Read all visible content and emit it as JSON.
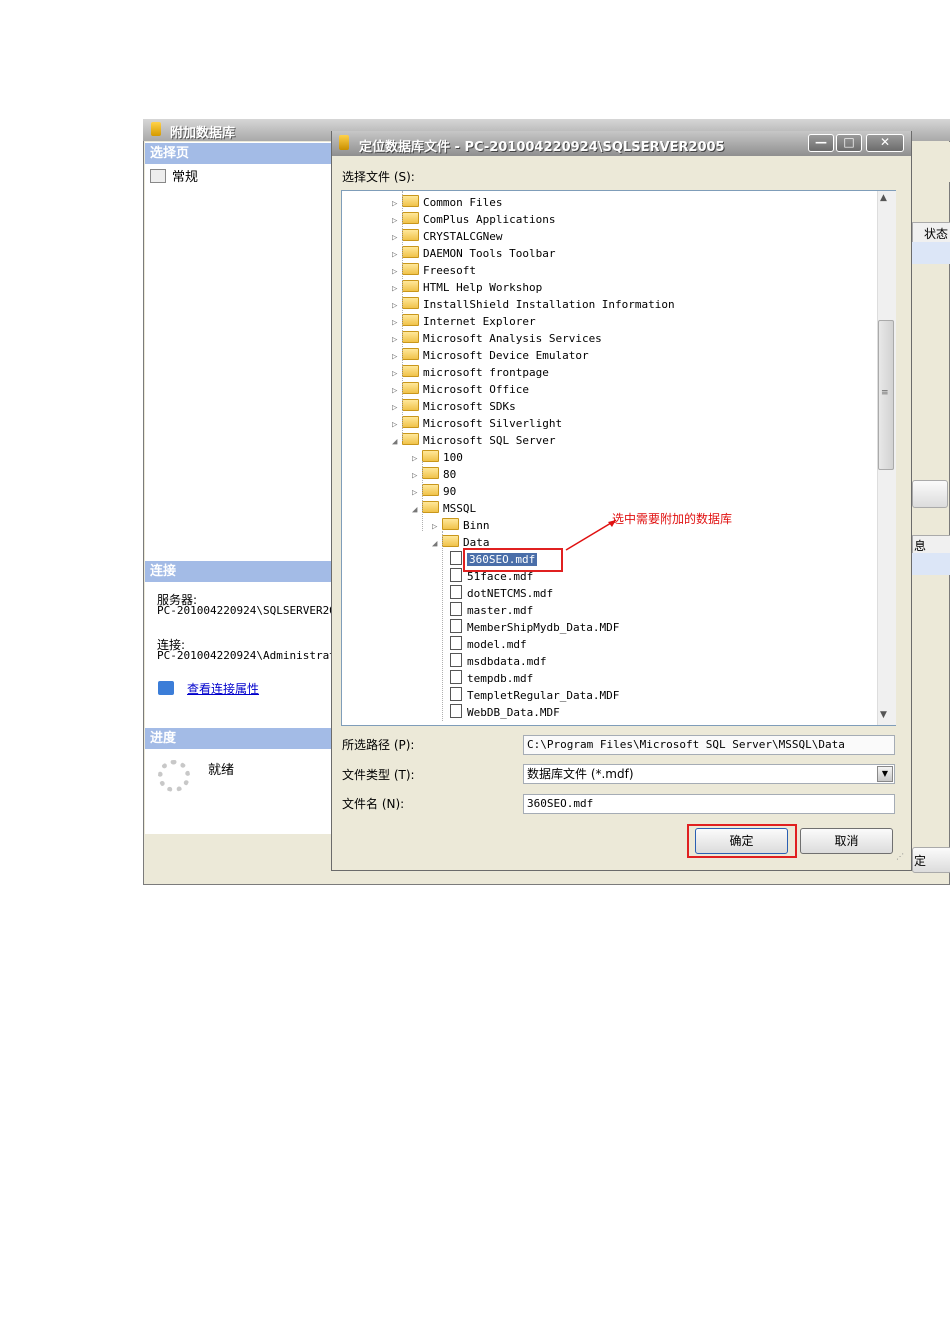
{
  "background_window": {
    "title": "附加数据库",
    "select_page_header": "选择页",
    "nav_general": "常规",
    "connection_header": "连接",
    "server_label": "服务器:",
    "server_value": "PC-201004220924\\SQLSERVER20",
    "connection_label": "连接:",
    "connection_value": "PC-201004220924\\Administrat",
    "view_props_link": "查看连接属性",
    "progress_header": "进度",
    "progress_status": "就绪",
    "right_col_header": "状态",
    "right_fragment_1": "息",
    "right_fragment_2": "定"
  },
  "dialog": {
    "title": "定位数据库文件 - PC-201004220924\\SQLSERVER2005",
    "window_buttons": [
      "—",
      "□",
      "✕"
    ],
    "select_file_label": "选择文件 (S):",
    "tree": [
      {
        "label": "Common Files",
        "type": "folder",
        "depth": 0,
        "expander": "▷"
      },
      {
        "label": "ComPlus Applications",
        "type": "folder",
        "depth": 0,
        "expander": "▷"
      },
      {
        "label": "CRYSTALCGNew",
        "type": "folder",
        "depth": 0,
        "expander": "▷"
      },
      {
        "label": "DAEMON Tools Toolbar",
        "type": "folder",
        "depth": 0,
        "expander": "▷"
      },
      {
        "label": "Freesoft",
        "type": "folder",
        "depth": 0,
        "expander": "▷"
      },
      {
        "label": "HTML Help Workshop",
        "type": "folder",
        "depth": 0,
        "expander": "▷"
      },
      {
        "label": "InstallShield Installation Information",
        "type": "folder",
        "depth": 0,
        "expander": "▷"
      },
      {
        "label": "Internet Explorer",
        "type": "folder",
        "depth": 0,
        "expander": "▷"
      },
      {
        "label": "Microsoft Analysis Services",
        "type": "folder",
        "depth": 0,
        "expander": "▷"
      },
      {
        "label": "Microsoft Device Emulator",
        "type": "folder",
        "depth": 0,
        "expander": "▷"
      },
      {
        "label": "microsoft frontpage",
        "type": "folder",
        "depth": 0,
        "expander": "▷"
      },
      {
        "label": "Microsoft Office",
        "type": "folder",
        "depth": 0,
        "expander": "▷"
      },
      {
        "label": "Microsoft SDKs",
        "type": "folder",
        "depth": 0,
        "expander": "▷"
      },
      {
        "label": "Microsoft Silverlight",
        "type": "folder",
        "depth": 0,
        "expander": "▷"
      },
      {
        "label": "Microsoft SQL Server",
        "type": "folder",
        "depth": 0,
        "expander": "◢"
      },
      {
        "label": "100",
        "type": "folder",
        "depth": 1,
        "expander": "▷"
      },
      {
        "label": "80",
        "type": "folder",
        "depth": 1,
        "expander": "▷"
      },
      {
        "label": "90",
        "type": "folder",
        "depth": 1,
        "expander": "▷"
      },
      {
        "label": "MSSQL",
        "type": "folder",
        "depth": 1,
        "expander": "◢"
      },
      {
        "label": "Binn",
        "type": "folder",
        "depth": 2,
        "expander": "▷"
      },
      {
        "label": "Data",
        "type": "folder",
        "depth": 2,
        "expander": "◢"
      },
      {
        "label": "360SEO.mdf",
        "type": "file",
        "depth": 3,
        "expander": "",
        "selected": true
      },
      {
        "label": "51face.mdf",
        "type": "file",
        "depth": 3,
        "expander": ""
      },
      {
        "label": "dotNETCMS.mdf",
        "type": "file",
        "depth": 3,
        "expander": ""
      },
      {
        "label": "master.mdf",
        "type": "file",
        "depth": 3,
        "expander": ""
      },
      {
        "label": "MemberShipMydb_Data.MDF",
        "type": "file",
        "depth": 3,
        "expander": ""
      },
      {
        "label": "model.mdf",
        "type": "file",
        "depth": 3,
        "expander": ""
      },
      {
        "label": "msdbdata.mdf",
        "type": "file",
        "depth": 3,
        "expander": ""
      },
      {
        "label": "tempdb.mdf",
        "type": "file",
        "depth": 3,
        "expander": ""
      },
      {
        "label": "TempletRegular_Data.MDF",
        "type": "file",
        "depth": 3,
        "expander": ""
      },
      {
        "label": "WebDB_Data.MDF",
        "type": "file",
        "depth": 3,
        "expander": ""
      }
    ],
    "selected_path_label": "所选路径 (P):",
    "selected_path_value": "C:\\Program Files\\Microsoft SQL Server\\MSSQL\\Data",
    "file_type_label": "文件类型 (T):",
    "file_type_value": "数据库文件 (*.mdf)",
    "file_name_label": "文件名 (N):",
    "file_name_value": "360SEO.mdf",
    "ok_label": "确定",
    "cancel_label": "取消"
  },
  "annotation": {
    "text": "选中需要附加的数据库",
    "color": "#e01010"
  },
  "colors": {
    "section_header": "#a3bbe6",
    "selection": "#4a6ea9",
    "link": "#0000cc"
  }
}
